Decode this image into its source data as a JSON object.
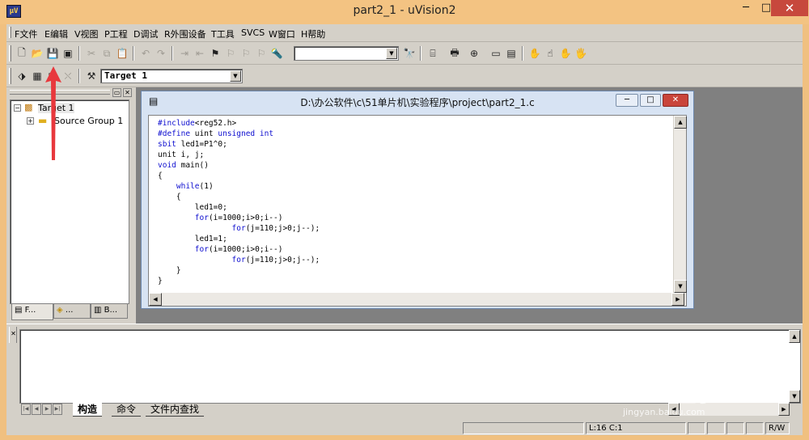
{
  "window": {
    "title": "part2_1  - uVision2",
    "icon_text": "μV",
    "min_glyph": "─",
    "max_glyph": "□",
    "close_glyph": "✕"
  },
  "menu": [
    {
      "label": "F文件"
    },
    {
      "label": "E编辑"
    },
    {
      "label": "V视图"
    },
    {
      "label": "P工程"
    },
    {
      "label": "D调试"
    },
    {
      "label": "R外围设备"
    },
    {
      "label": "T工具"
    },
    {
      "label": "SVCS"
    },
    {
      "label": "W窗口"
    },
    {
      "label": "H帮助"
    }
  ],
  "toolbar2": {
    "target_select": "Target 1"
  },
  "project": {
    "tree": [
      {
        "label": "Target 1",
        "expander": "−"
      },
      {
        "label": "Source Group 1",
        "expander": "+"
      }
    ],
    "tabs": [
      {
        "label": "F..."
      },
      {
        "label": "..."
      },
      {
        "label": "B..."
      }
    ]
  },
  "editor": {
    "title": "D:\\办公软件\\c\\51单片机\\实验程序\\project\\part2_1.c",
    "lines": [
      "#include<reg52.h>",
      "#define uint unsigned int",
      "sbit led1=P1^0;",
      "unit i, j;",
      "void main()",
      "{",
      "    while(1)",
      "    {",
      "        led1=0;",
      "        for(i=1000;i>0;i--)",
      "                for(j=110;j>0;j--);",
      "        led1=1;",
      "        for(i=1000;i>0;i--)",
      "                for(j=110;j>0;j--);",
      "    }",
      "}"
    ]
  },
  "output": {
    "tabs": [
      {
        "label": "构造"
      },
      {
        "label": "命令"
      },
      {
        "label": "文件内查找"
      }
    ]
  },
  "status": {
    "position": "L:16 C:1",
    "mode": "R/W"
  },
  "watermark": {
    "brand": "Bai经验",
    "url": "jingyan.baidu.com"
  },
  "colors": {
    "keyword": "#1010d0",
    "annotation_arrow": "#e8383d"
  }
}
